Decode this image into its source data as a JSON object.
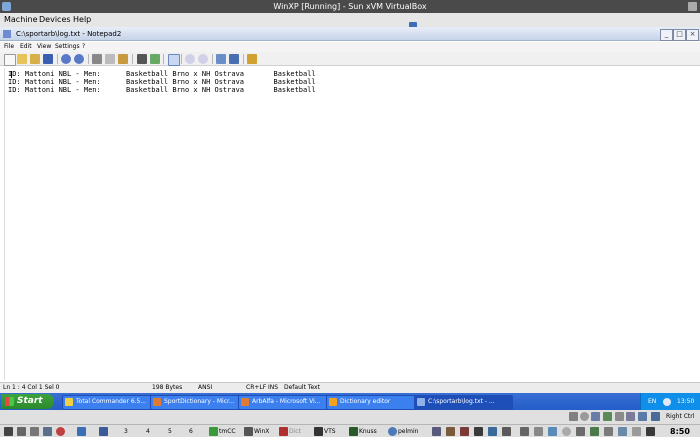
{
  "host_window": {
    "title": "WinXP [Running] - Sun xVM VirtualBox"
  },
  "host_menu": {
    "items": [
      "Machine",
      "Devices",
      "Help"
    ]
  },
  "app_window": {
    "title": "C:\\sportarb\\log.txt - Notepad2"
  },
  "app_menu": {
    "items": [
      "File",
      "Edit",
      "View",
      "Settings",
      "?"
    ]
  },
  "editor": {
    "lines": [
      "ID: Mattoni NBL - Men:      Basketball Brno x NH Ostrava       Basketball",
      "ID: Mattoni NBL - Men:      Basketball Brno x NH Ostrava       Basketball",
      "ID: Mattoni NBL - Men:      Basketball Brno x NH Ostrava       Basketball"
    ]
  },
  "status_bar": {
    "position": "Ln 1 : 4   Col 1   Sel 0",
    "size": "198 Bytes",
    "encoding": "ANSI",
    "line_endings": "CR+LF",
    "ins": "INS",
    "scheme": "Default Text"
  },
  "taskbar": {
    "start_label": "Start",
    "tasks": [
      "Total Commander 6.5...",
      "SportDictionary - Micr...",
      "ArbAlfa - Microsoft Vi...",
      "Dictionary editor",
      "C:\\sportarb\\log.txt - ..."
    ],
    "language": "EN",
    "clock": "13:50"
  },
  "host_status": {
    "right_ctrl": "Right Ctrl"
  },
  "host_panel": {
    "workspaces": [
      "3",
      "4",
      "5",
      "6"
    ],
    "apps": [
      "tmCC",
      "WinX",
      "Dict",
      "VTS",
      "Knuss",
      "pelmin"
    ],
    "clock": "8:50"
  }
}
